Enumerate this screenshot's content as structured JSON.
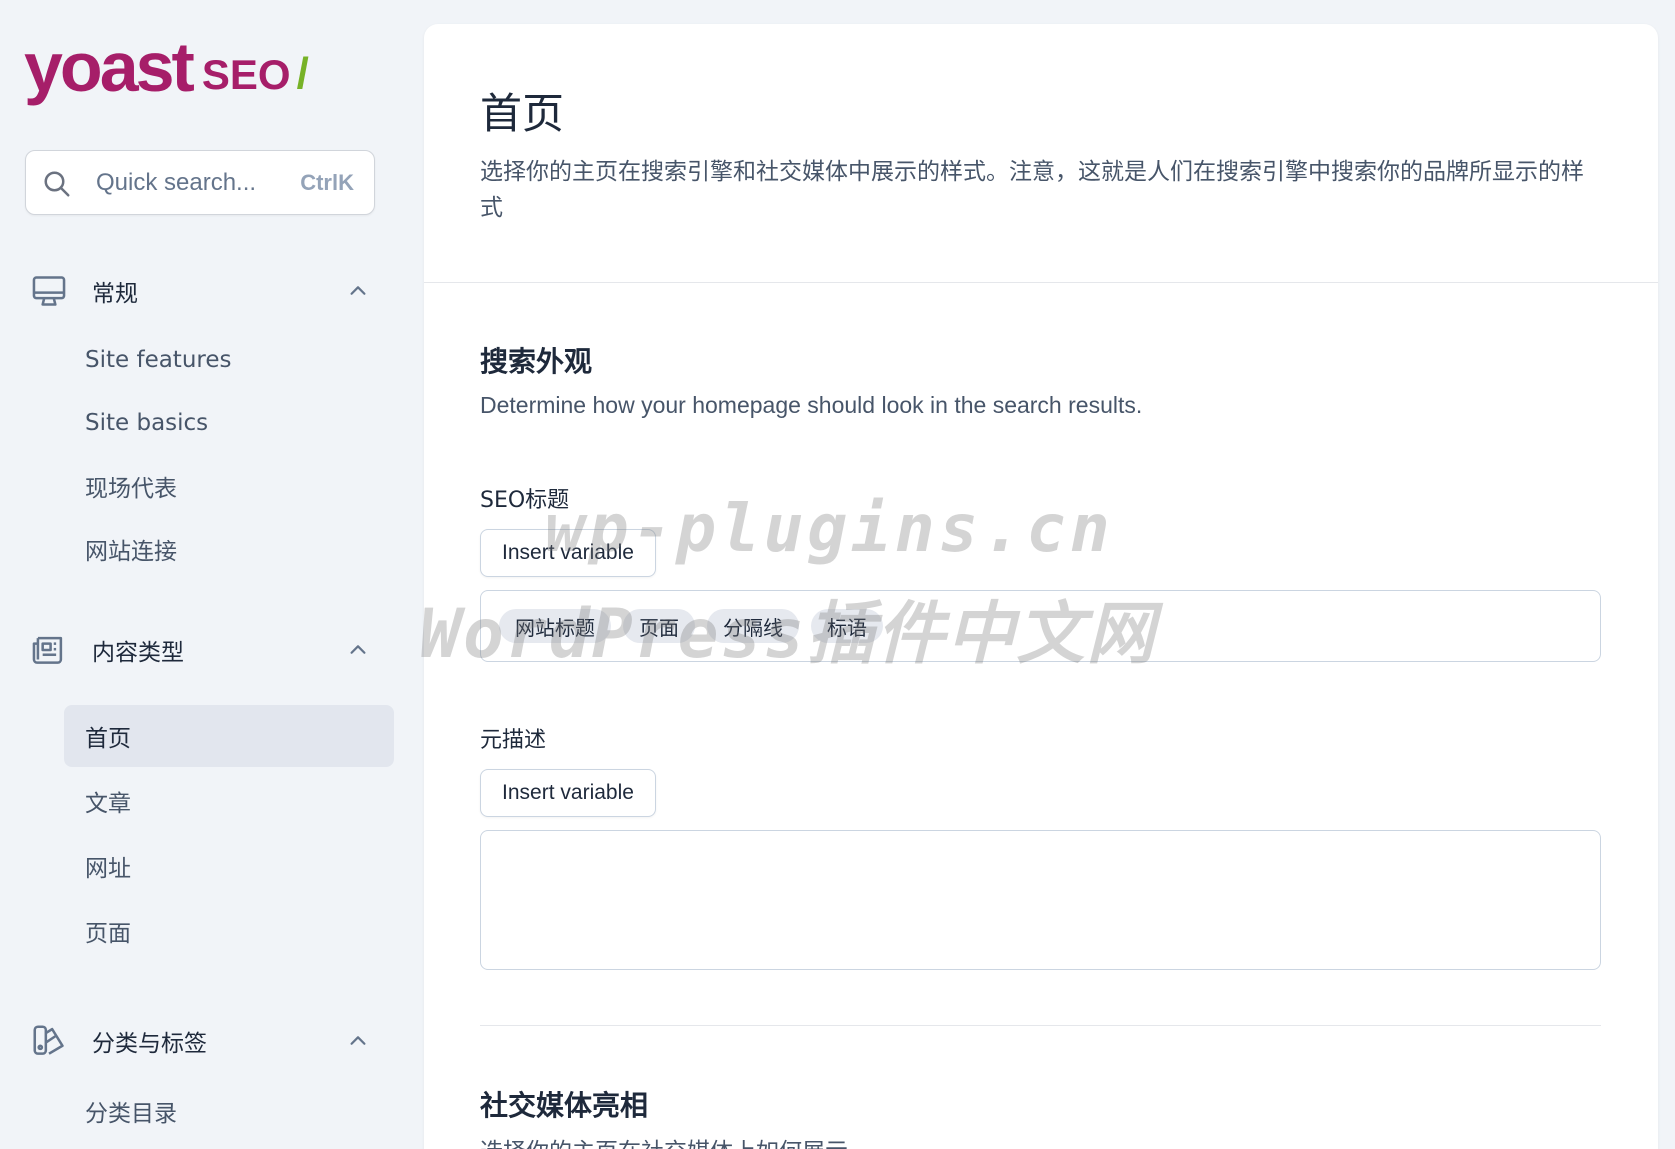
{
  "brand": {
    "name_main": "yoast",
    "name_suffix": "SEO",
    "slash": "/",
    "primary_color": "#a61e69",
    "accent_color": "#77b227"
  },
  "search": {
    "placeholder": "Quick search...",
    "shortcut": "CtrlK",
    "icon": "search-icon"
  },
  "sidebar": {
    "sections": [
      {
        "label": "常规",
        "icon": "desktop-icon",
        "expanded": true,
        "items": [
          "Site features",
          "Site basics",
          "现场代表",
          "网站连接"
        ]
      },
      {
        "label": "内容类型",
        "icon": "newspaper-icon",
        "expanded": true,
        "items": [
          "首页",
          "文章",
          "网址",
          "页面"
        ],
        "active_item": "首页"
      },
      {
        "label": "分类与标签",
        "icon": "tags-icon",
        "expanded": true,
        "items": [
          "分类目录"
        ]
      }
    ]
  },
  "main": {
    "title": "首页",
    "description": "选择你的主页在搜索引擎和社交媒体中展示的样式。注意，这就是人们在搜索引擎中搜索你的品牌所显示的样式",
    "search_appearance": {
      "title": "搜索外观",
      "subtitle": "Determine how your homepage should look in the search results.",
      "seo_title_label": "SEO标题",
      "insert_variable": "Insert variable",
      "title_chips": [
        "网站标题",
        "页面",
        "分隔线",
        "标语"
      ],
      "meta_label": "元描述",
      "meta_insert_variable": "Insert variable",
      "meta_value": ""
    },
    "social": {
      "title": "社交媒体亮相",
      "subtitle": "选择你的主页在社交媒体上如何展示"
    }
  },
  "watermark": {
    "line1": "wp-plugins.cn",
    "line2": "WordPress插件中文网"
  }
}
